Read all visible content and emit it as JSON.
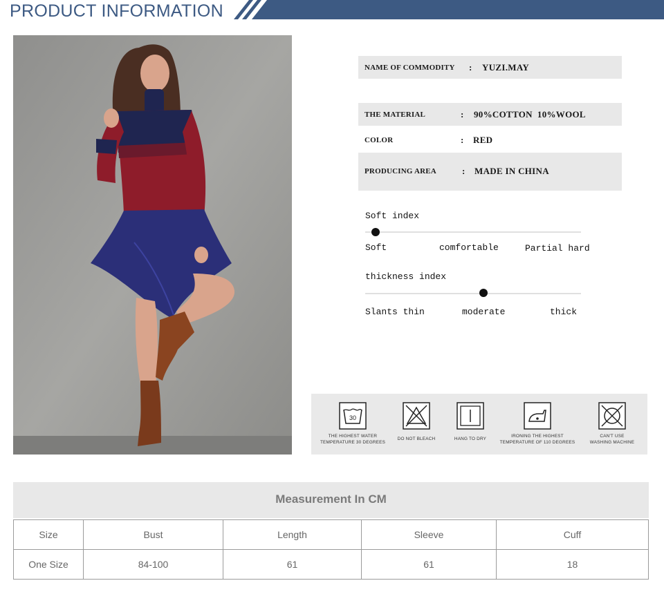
{
  "header": {
    "title": "PRODUCT INFORMATION"
  },
  "photo": {
    "subject": "model-photo"
  },
  "specs": [
    {
      "label": "NAME OF COMMODITY",
      "colon": ":",
      "value": "YUZI.MAY"
    },
    {
      "label": "THE MATERIAL",
      "colon": ":",
      "value": "90%COTTON  10%WOOL"
    },
    {
      "label": "COLOR",
      "colon": ":",
      "value": "RED"
    },
    {
      "label": "PRODUCING AREA",
      "colon": ":",
      "value": "MADE IN CHINA"
    }
  ],
  "soft_index": {
    "title": "Soft index",
    "labels": [
      "Soft",
      "comfortable",
      "Partial hard"
    ],
    "selected": "Soft"
  },
  "thickness_index": {
    "title": "thickness index",
    "labels": [
      "Slants thin",
      "moderate",
      "thick"
    ],
    "selected": "moderate"
  },
  "care": [
    {
      "icon": "wash-30-icon",
      "badge": "30",
      "line1": "THE HIGHEST WATER",
      "line2": "TEMPERATURE 30 DEGREES"
    },
    {
      "icon": "no-bleach-icon",
      "line1": "DO NOT BLEACH",
      "line2": ""
    },
    {
      "icon": "hang-dry-icon",
      "line1": "HANG TO DRY",
      "line2": ""
    },
    {
      "icon": "iron-110-icon",
      "line1": "IRONING THE HIGHEST",
      "line2": "TEMPERATURE OF 110 DEGREES"
    },
    {
      "icon": "no-machine-wash-icon",
      "line1": "CAN'T USE",
      "line2": "WASHING MACHINE"
    }
  ],
  "measurement": {
    "title": "Measurement In CM",
    "headers": [
      "Size",
      "Bust",
      "Length",
      "Sleeve",
      "Cuff"
    ],
    "rows": [
      [
        "One Size",
        "84-100",
        "61",
        "61",
        "18"
      ]
    ]
  },
  "colors": {
    "accent": "#3d5a83",
    "panel": "#e8e8e8",
    "sweater": "#8e1c2a",
    "navy": "#1f2550"
  }
}
